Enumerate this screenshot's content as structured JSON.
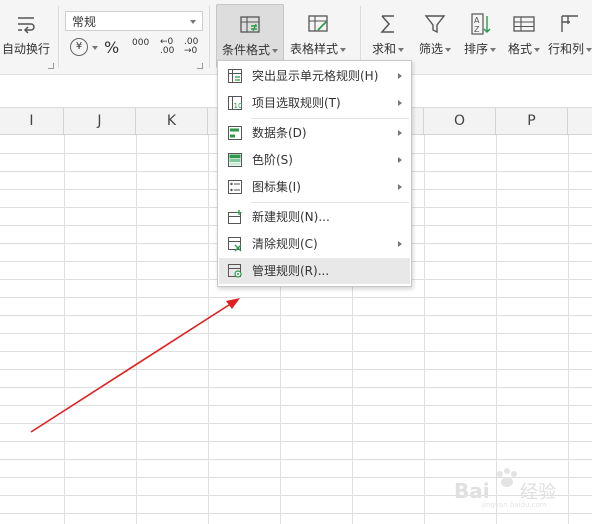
{
  "ribbon": {
    "wrap_label": "自动换行",
    "number_format_value": "常规",
    "currency_symbol": "¥",
    "percent_symbol": "%",
    "thousands_symbol": "000",
    "increase_decimal": "←0 .00",
    "decrease_decimal": ".00 →0",
    "cond_format_label": "条件格式",
    "table_style_label": "表格样式",
    "sum_label": "求和",
    "filter_label": "筛选",
    "sort_label": "排序",
    "format_label": "格式",
    "rowcol_label": "行和列"
  },
  "columns": [
    "I",
    "J",
    "K",
    "O",
    "P"
  ],
  "menu": {
    "items": [
      {
        "label": "突出显示单元格规则(H)",
        "icon": "highlight-cells-icon",
        "submenu": true
      },
      {
        "label": "项目选取规则(T)",
        "icon": "top-bottom-icon",
        "submenu": true
      },
      {
        "label": "数据条(D)",
        "icon": "data-bars-icon",
        "submenu": true
      },
      {
        "label": "色阶(S)",
        "icon": "color-scale-icon",
        "submenu": true
      },
      {
        "label": "图标集(I)",
        "icon": "icon-sets-icon",
        "submenu": true
      },
      {
        "label": "新建规则(N)...",
        "icon": "new-rule-icon",
        "submenu": false
      },
      {
        "label": "清除规则(C)",
        "icon": "clear-rules-icon",
        "submenu": true
      },
      {
        "label": "管理规则(R)...",
        "icon": "manage-rules-icon",
        "submenu": false,
        "highlighted": true
      }
    ]
  },
  "annotation": {
    "arrow_color": "#e02020"
  },
  "watermark": {
    "text": "Bai 经验",
    "sub": "jingyan.baidu.com"
  }
}
